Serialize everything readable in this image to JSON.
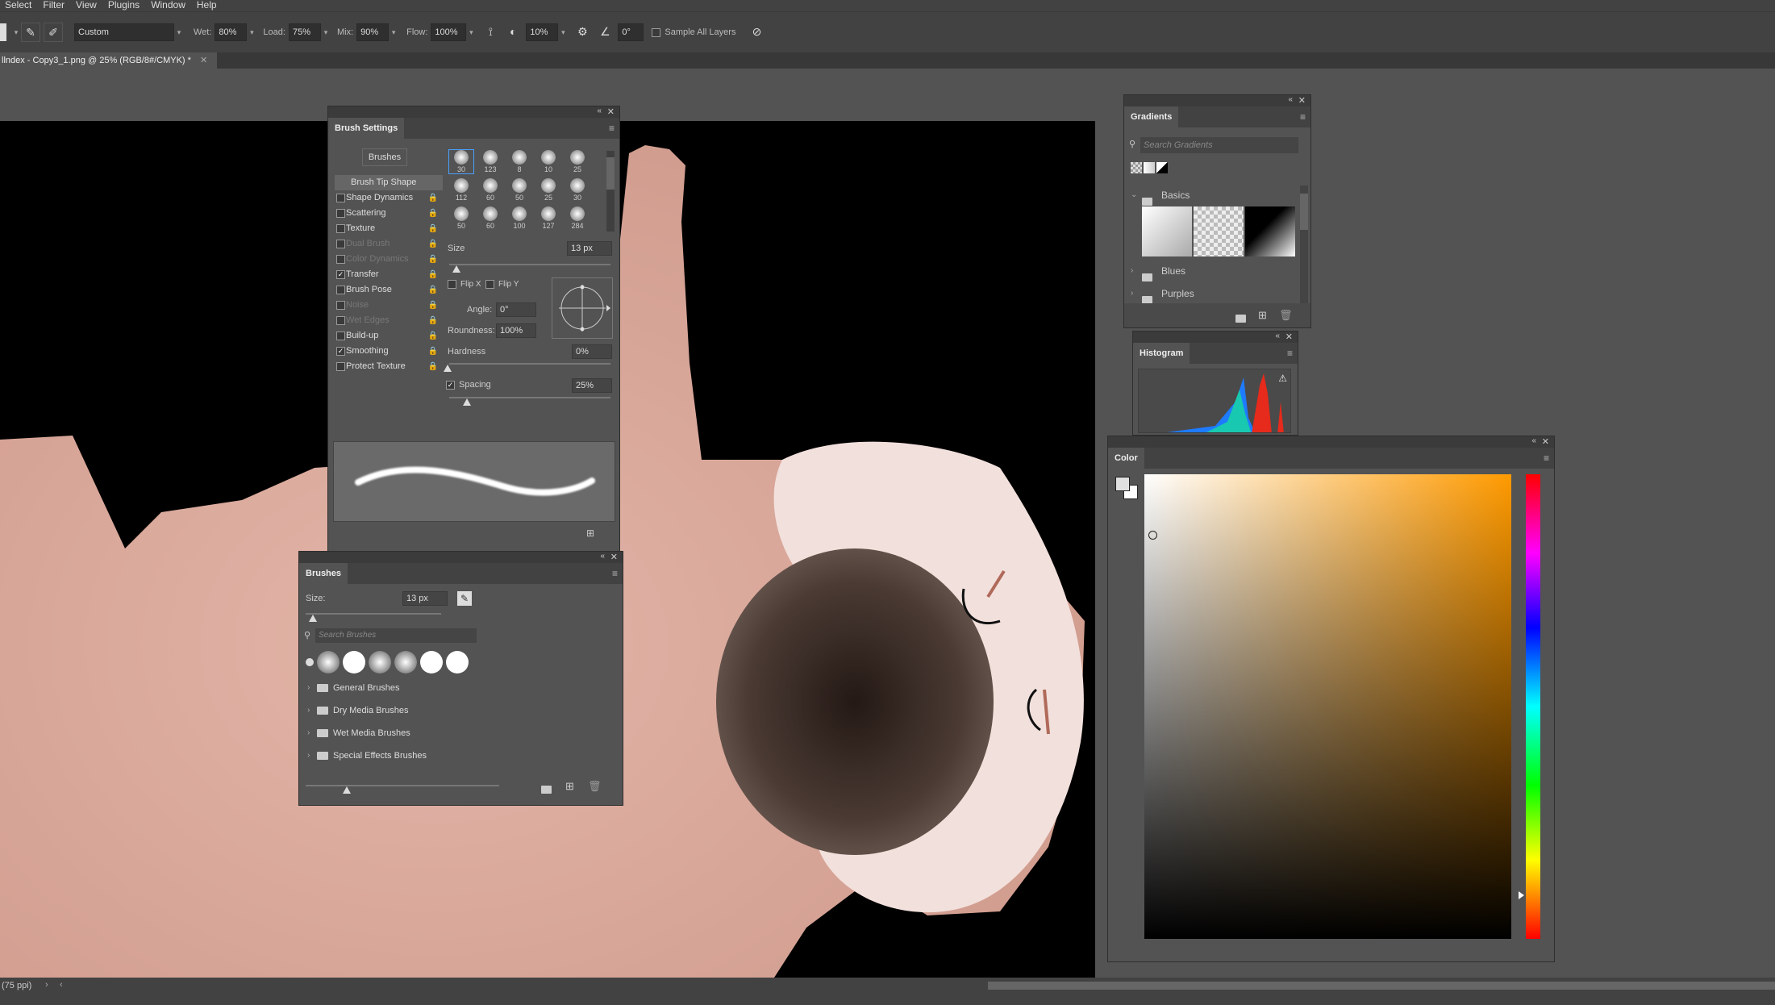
{
  "menu": [
    "Select",
    "Filter",
    "View",
    "Plugins",
    "Window",
    "Help"
  ],
  "options": {
    "preset": "Custom",
    "wet_label": "Wet:",
    "wet": "80%",
    "load_label": "Load:",
    "load": "75%",
    "mix_label": "Mix:",
    "mix": "90%",
    "flow_label": "Flow:",
    "flow": "100%",
    "smoothing": "10%",
    "angle": "0°",
    "sample_all_layers": "Sample All Layers"
  },
  "document_tab": "llndex - Copy3_1.png @ 25% (RGB/8#/CMYK) *",
  "status": {
    "ppi": "(75 ppi)"
  },
  "brush_settings": {
    "title": "Brush Settings",
    "brushes_button": "Brushes",
    "items": [
      {
        "label": "Brush Tip Shape",
        "checkbox": false,
        "checked": false,
        "disabled": false,
        "selected": true
      },
      {
        "label": "Shape Dynamics",
        "checkbox": true,
        "checked": false,
        "disabled": false
      },
      {
        "label": "Scattering",
        "checkbox": true,
        "checked": false,
        "disabled": false
      },
      {
        "label": "Texture",
        "checkbox": true,
        "checked": false,
        "disabled": false
      },
      {
        "label": "Dual Brush",
        "checkbox": true,
        "checked": false,
        "disabled": true
      },
      {
        "label": "Color Dynamics",
        "checkbox": true,
        "checked": false,
        "disabled": true
      },
      {
        "label": "Transfer",
        "checkbox": true,
        "checked": true,
        "disabled": false
      },
      {
        "label": "Brush Pose",
        "checkbox": true,
        "checked": false,
        "disabled": false
      },
      {
        "label": "Noise",
        "checkbox": true,
        "checked": false,
        "disabled": true
      },
      {
        "label": "Wet Edges",
        "checkbox": true,
        "checked": false,
        "disabled": true
      },
      {
        "label": "Build-up",
        "checkbox": true,
        "checked": false,
        "disabled": false
      },
      {
        "label": "Smoothing",
        "checkbox": true,
        "checked": true,
        "disabled": false
      },
      {
        "label": "Protect Texture",
        "checkbox": true,
        "checked": false,
        "disabled": false
      }
    ],
    "tips": [
      "30",
      "123",
      "8",
      "10",
      "25",
      "112",
      "60",
      "50",
      "25",
      "30",
      "50",
      "60",
      "100",
      "127",
      "284"
    ],
    "size_label": "Size",
    "size": "13 px",
    "flip_x": "Flip X",
    "flip_y": "Flip Y",
    "angle_label": "Angle:",
    "angle": "0°",
    "roundness_label": "Roundness:",
    "roundness": "100%",
    "hardness_label": "Hardness",
    "hardness": "0%",
    "spacing_label": "Spacing",
    "spacing": "25%"
  },
  "brushes_panel": {
    "title": "Brushes",
    "size_label": "Size:",
    "size": "13 px",
    "search_placeholder": "Search Brushes",
    "folders": [
      "General Brushes",
      "Dry Media Brushes",
      "Wet Media Brushes",
      "Special Effects Brushes"
    ]
  },
  "gradients_panel": {
    "title": "Gradients",
    "search_placeholder": "Search Gradients",
    "groups": [
      "Basics",
      "Blues",
      "Purples"
    ]
  },
  "histogram_panel": {
    "title": "Histogram"
  },
  "color_panel": {
    "title": "Color"
  }
}
